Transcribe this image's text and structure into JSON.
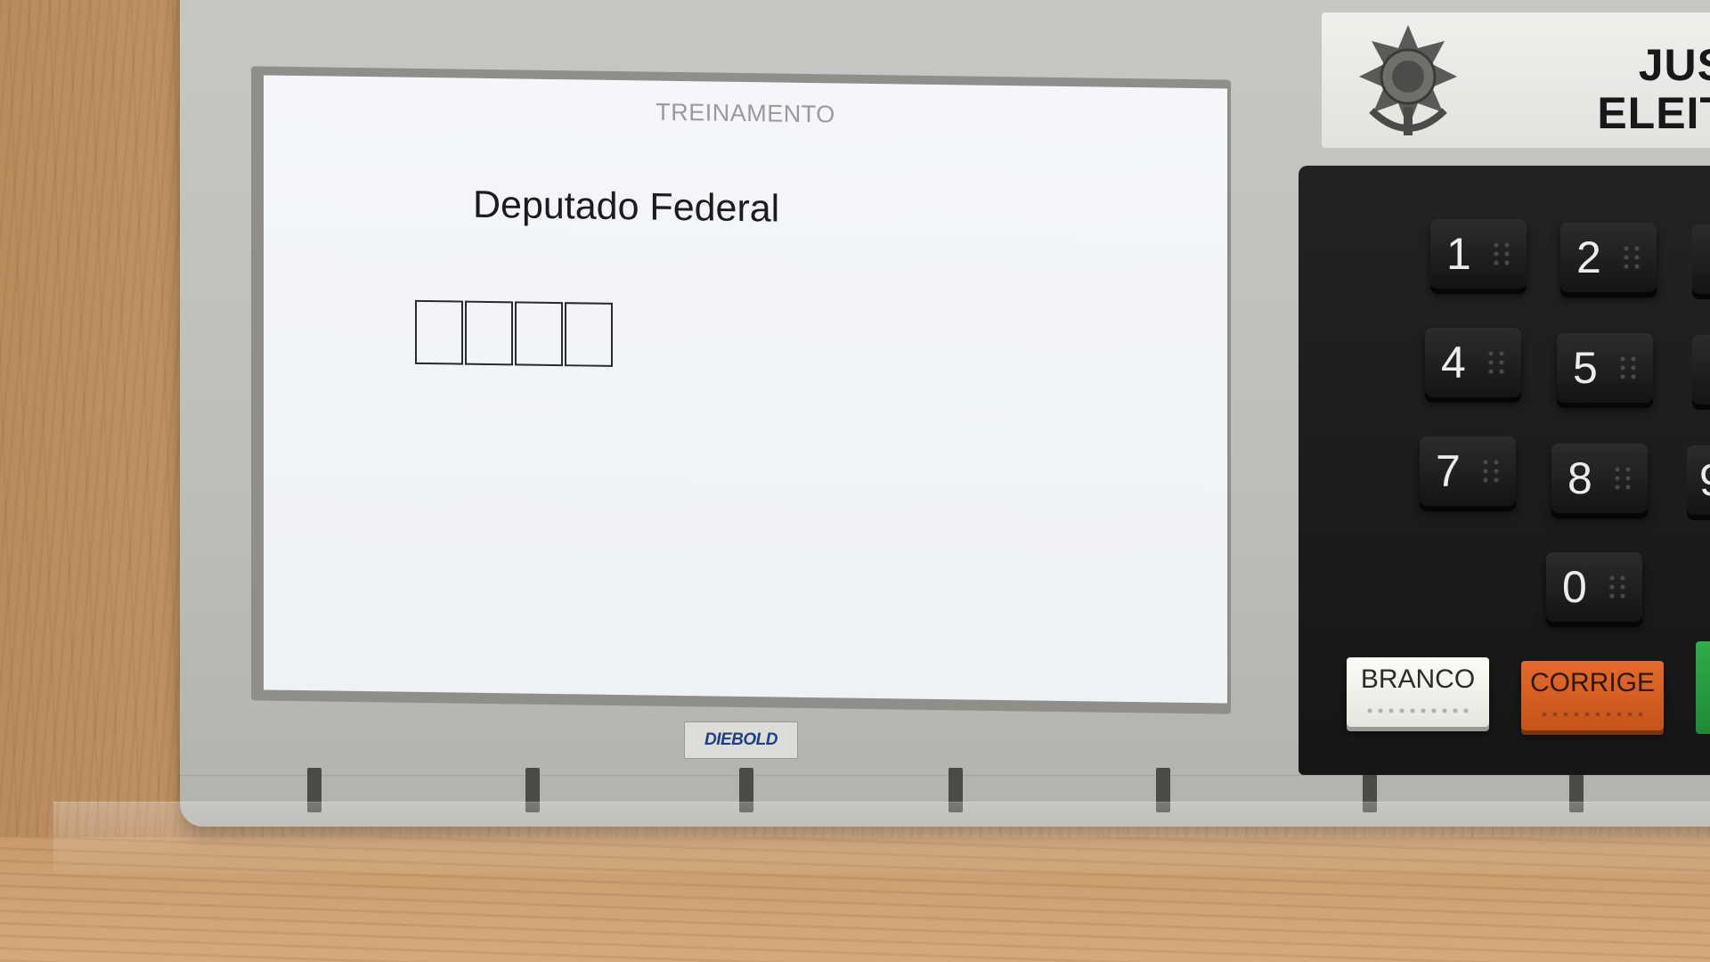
{
  "screen": {
    "header": "TREINAMENTO",
    "office_title": "Deputado Federal",
    "digit_count": 4
  },
  "brand": {
    "name": "DIEBOLD"
  },
  "label_panel": {
    "line1": "JUS",
    "line2": "ELEIT"
  },
  "keypad": {
    "keys": [
      "1",
      "2",
      "4",
      "5",
      "7",
      "8",
      "0"
    ],
    "partial_keys": [
      "9"
    ],
    "branco_label": "BRANCO",
    "corrige_label": "CORRIGE"
  },
  "colors": {
    "screen_bg": "#eef1f6",
    "casing": "#c8c7c2",
    "keypad_bg": "#1c1c1c",
    "branco": "#f4f4f0",
    "corrige": "#d85f22",
    "confirma": "#2fae4a",
    "brand_text": "#1d3f86"
  },
  "icons": {
    "emblem": "coat-of-arms-icon"
  }
}
